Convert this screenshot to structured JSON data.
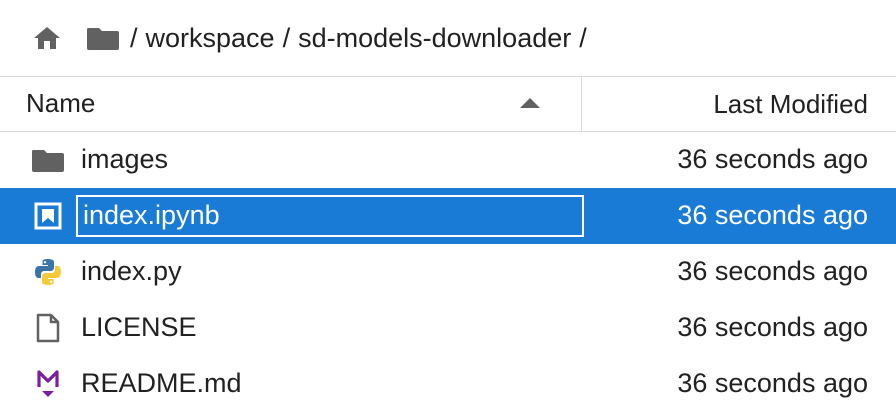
{
  "breadcrumb": {
    "home_icon": "home-icon",
    "folder_icon": "folder-icon",
    "separator": "/",
    "segments": [
      "workspace",
      "sd-models-downloader"
    ]
  },
  "header": {
    "name_label": "Name",
    "modified_label": "Last Modified",
    "sort_direction": "ascending"
  },
  "files": [
    {
      "name": "images",
      "icon": "folder-icon",
      "modified": "36 seconds ago",
      "selected": false
    },
    {
      "name": "index.ipynb",
      "icon": "notebook-icon",
      "modified": "36 seconds ago",
      "selected": true,
      "renaming": true
    },
    {
      "name": "index.py",
      "icon": "python-icon",
      "modified": "36 seconds ago",
      "selected": false
    },
    {
      "name": "LICENSE",
      "icon": "file-icon",
      "modified": "36 seconds ago",
      "selected": false
    },
    {
      "name": "README.md",
      "icon": "markdown-icon",
      "modified": "36 seconds ago",
      "selected": false
    }
  ],
  "colors": {
    "selection": "#1a7bd6",
    "icon_gray": "#616161",
    "markdown_purple": "#7b1fa2",
    "python_blue": "#3b75a8",
    "python_yellow": "#f5c93b"
  }
}
